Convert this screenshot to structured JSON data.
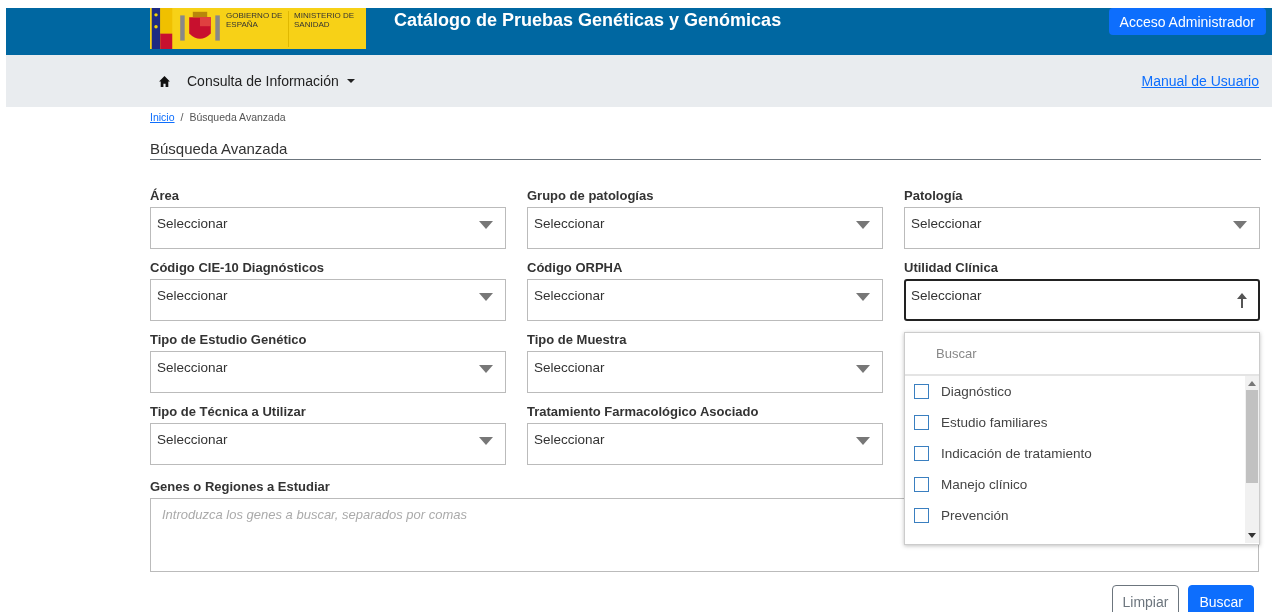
{
  "header": {
    "logo_left": "GOBIERNO DE ESPAÑA",
    "logo_right": "MINISTERIO DE SANIDAD",
    "title": "Catálogo de Pruebas Genéticas y Genómicas",
    "admin_button": "Acceso Administrador"
  },
  "nav": {
    "menu": "Consulta de Información",
    "manual_link": "Manual de Usuario"
  },
  "breadcrumb_separator": "/",
  "breadcrumb": [
    {
      "label": "Inicio",
      "kind": "link"
    },
    {
      "label": "Búsqueda Avanzada",
      "kind": "current"
    }
  ],
  "section_title": "Búsqueda Avanzada",
  "fields": [
    {
      "label": "Área",
      "value": "Seleccionar",
      "expanded": false
    },
    {
      "label": "Grupo de patologías",
      "value": "Seleccionar",
      "expanded": false
    },
    {
      "label": "Patología",
      "value": "Seleccionar",
      "expanded": false
    },
    {
      "label": "Código CIE-10 Diagnósticos",
      "value": "Seleccionar",
      "expanded": false
    },
    {
      "label": "Código ORPHA",
      "value": "Seleccionar",
      "expanded": false
    },
    {
      "label": "Utilidad Clínica",
      "value": "Seleccionar",
      "expanded": true
    },
    {
      "label": "Tipo de Estudio Genético",
      "value": "Seleccionar",
      "expanded": false
    },
    {
      "label": "Tipo de Muestra",
      "value": "Seleccionar",
      "expanded": false
    },
    {
      "label": "Tipo de Técnica a Utilizar",
      "value": "Seleccionar",
      "expanded": false
    },
    {
      "label": "Tratamiento Farmacológico Asociado",
      "value": "Seleccionar",
      "expanded": false
    }
  ],
  "dropdown": {
    "search_placeholder": "Buscar",
    "options": [
      {
        "label": "Diagnóstico",
        "checked": false
      },
      {
        "label": "Estudio familiares",
        "checked": false
      },
      {
        "label": "Indicación de tratamiento",
        "checked": false
      },
      {
        "label": "Manejo clínico",
        "checked": false
      },
      {
        "label": "Prevención",
        "checked": false
      }
    ]
  },
  "genes": {
    "label": "Genes o Regiones a Estudiar",
    "placeholder": "Introduzca los genes a buscar, separados por comas"
  },
  "buttons": [
    {
      "label": "Limpiar",
      "kind": "secondary"
    },
    {
      "label": "Buscar",
      "kind": "primary"
    }
  ]
}
